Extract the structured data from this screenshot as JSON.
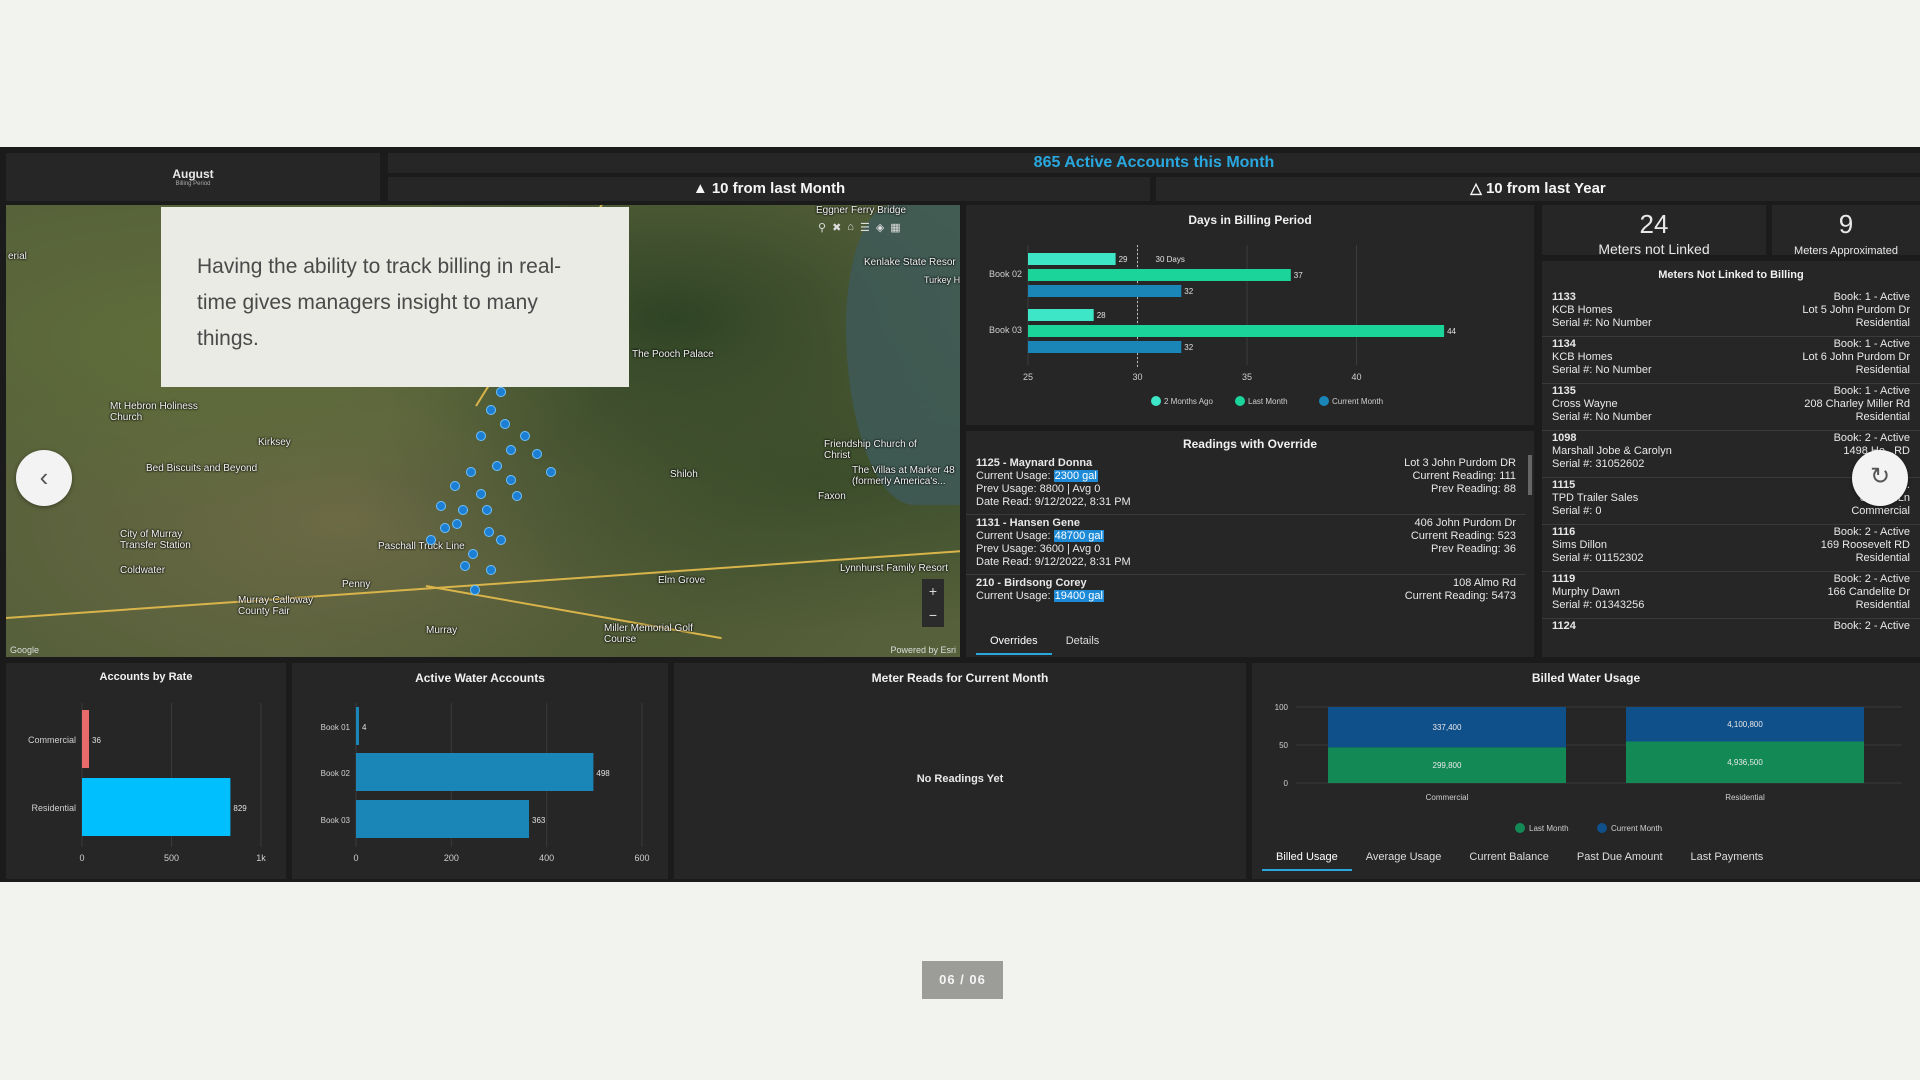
{
  "header": {
    "month": "August",
    "month_sub": "Billing Period",
    "active_accounts": "865 Active Accounts this Month",
    "from_last_month": "▲ 10 from last Month",
    "from_last_year": "△ 10 from last Year"
  },
  "overlay_text": "Having the ability to track billing in real-time gives managers insight to many things.",
  "map": {
    "labels": [
      "Eggner Ferry Bridge",
      "Kenlake State Resor",
      "Turkey Highway Vehic",
      "The Pooch Palace",
      "Mt Hebron Holiness Church",
      "Kirksey",
      "Bed Biscuits and Beyond",
      "Friendship Church of Christ",
      "The Villas at Marker 48 (formerly America's...",
      "Faxon",
      "Shiloh",
      "City of Murray Transfer Station",
      "Coldwater",
      "Paschall Truck Line",
      "Penny",
      "Murray-Calloway County Fair",
      "Murray",
      "Elm Grove",
      "Lynnhurst Family Resort",
      "Miller Memorial Golf Course",
      "erial"
    ],
    "google": "Google",
    "powered": "Powered by Esri"
  },
  "stats": {
    "not_linked_count": "24",
    "not_linked_label": "Meters not Linked",
    "approx_count": "9",
    "approx_label": "Meters Approximated"
  },
  "not_linked": {
    "title": "Meters Not Linked to Billing",
    "rows": [
      {
        "id": "1133",
        "name": "KCB Homes",
        "serial": "Serial #: No Number",
        "book": "Book: 1 - Active",
        "addr": "Lot 5 John Purdom Dr",
        "type": "Residential"
      },
      {
        "id": "1134",
        "name": "KCB Homes",
        "serial": "Serial #: No Number",
        "book": "Book: 1 - Active",
        "addr": "Lot 6 John Purdom Dr",
        "type": "Residential"
      },
      {
        "id": "1135",
        "name": "Cross Wayne",
        "serial": "Serial #: No Number",
        "book": "Book: 1 - Active",
        "addr": "208 Charley Miller Rd",
        "type": "Residential"
      },
      {
        "id": "1098",
        "name": "Marshall Jobe & Carolyn",
        "serial": "Serial #: 31052602",
        "book": "Book: 2 - Active",
        "addr": "1498 Ho...RD",
        "type": ""
      },
      {
        "id": "1115",
        "name": "TPD Trailer Sales",
        "serial": "Serial #: 0",
        "book": "Boo...",
        "addr": "83 Sh...Ln",
        "type": "Commercial"
      },
      {
        "id": "1116",
        "name": "Sims Dillon",
        "serial": "Serial #: 01152302",
        "book": "Book: 2 - Active",
        "addr": "169 Roosevelt RD",
        "type": "Residential"
      },
      {
        "id": "1119",
        "name": "Murphy Dawn",
        "serial": "Serial #: 01343256",
        "book": "Book: 2 - Active",
        "addr": "166 Candelite Dr",
        "type": "Residential"
      },
      {
        "id": "1124",
        "name": "",
        "serial": "",
        "book": "Book: 2 - Active",
        "addr": "",
        "type": ""
      }
    ]
  },
  "overrides": {
    "title": "Readings with Override",
    "items": [
      {
        "head": "1125 - Maynard Donna",
        "usage_label": "Current Usage:",
        "usage": "2300 gal",
        "prev": "Prev Usage: 8800 | Avg 0",
        "date": "Date Read: 9/12/2022, 8:31 PM",
        "addr": "Lot 3 John Purdom DR",
        "cur_read": "Current Reading: 111",
        "prev_read": "Prev Reading: 88"
      },
      {
        "head": "1131 - Hansen Gene",
        "usage_label": "Current Usage:",
        "usage": "48700 gal",
        "prev": "Prev Usage: 3600 | Avg 0",
        "date": "Date Read: 9/12/2022, 8:31 PM",
        "addr": "406 John Purdom Dr",
        "cur_read": "Current Reading: 523",
        "prev_read": "Prev Reading: 36"
      },
      {
        "head": "210 - Birdsong Corey",
        "usage_label": "Current Usage:",
        "usage": "19400 gal",
        "prev": "",
        "date": "",
        "addr": "108 Almo Rd",
        "cur_read": "Current Reading: 5473",
        "prev_read": ""
      }
    ],
    "tabs": [
      "Overrides",
      "Details"
    ]
  },
  "meter_reads": {
    "title": "Meter Reads for Current Month",
    "empty": "No Readings Yet"
  },
  "billed_tabs": [
    "Billed Usage",
    "Average Usage",
    "Current Balance",
    "Past Due Amount",
    "Last Payments"
  ],
  "pager": "06 / 06",
  "colors": {
    "accent": "#29a8e0",
    "teal_light": "#3ee6c8",
    "teal": "#1bd49a",
    "blue": "#1a86b8",
    "cyan": "#00bfff",
    "red": "#e86a6a",
    "green": "#138a56",
    "navy": "#0f4f8a"
  },
  "chart_data": [
    {
      "type": "bar",
      "title": "Days in Billing Period",
      "orientation": "horizontal",
      "categories": [
        "Book 02",
        "Book 03"
      ],
      "series": [
        {
          "name": "2 Months Ago",
          "values": [
            29,
            28
          ]
        },
        {
          "name": "Last Month",
          "values": [
            37,
            44
          ]
        },
        {
          "name": "Current Month",
          "values": [
            32,
            32
          ]
        }
      ],
      "xlim": [
        25,
        45
      ],
      "xticks": [
        25,
        30,
        35,
        40
      ],
      "annotation": "30 Days",
      "legend": "bottom"
    },
    {
      "type": "bar",
      "title": "Accounts by Rate",
      "orientation": "horizontal",
      "categories": [
        "Commercial",
        "Residential"
      ],
      "values": [
        36,
        829
      ],
      "xlim": [
        0,
        1000
      ],
      "xticks": [
        "0",
        "500",
        "1k"
      ]
    },
    {
      "type": "bar",
      "title": "Active Water Accounts",
      "orientation": "horizontal",
      "categories": [
        "Book 01",
        "Book 02",
        "Book 03"
      ],
      "values": [
        4,
        498,
        363
      ],
      "xlim": [
        0,
        600
      ],
      "xticks": [
        0,
        200,
        400,
        600
      ]
    },
    {
      "type": "bar",
      "title": "Billed Water Usage",
      "stacked": true,
      "percent": true,
      "categories": [
        "Commercial",
        "Residential"
      ],
      "series": [
        {
          "name": "Last Month",
          "values": [
            299800,
            4936500
          ],
          "labels": [
            "299,800",
            "4,936,500"
          ]
        },
        {
          "name": "Current Month",
          "values": [
            337400,
            4100800
          ],
          "labels": [
            "337,400",
            "4,100,800"
          ]
        }
      ],
      "ylim": [
        0,
        100
      ],
      "yticks": [
        0,
        50,
        100
      ],
      "legend": "bottom"
    }
  ]
}
